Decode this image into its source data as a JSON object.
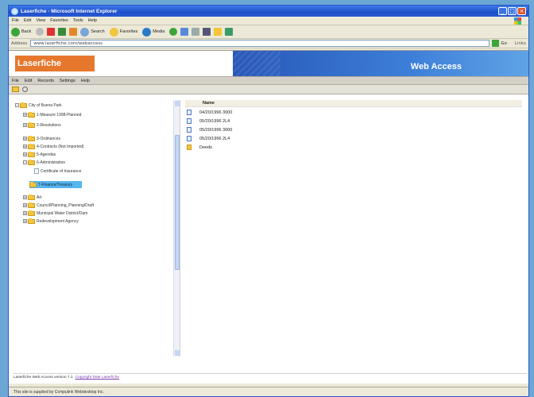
{
  "window": {
    "title": "Laserfiche - Microsoft Internet Explorer"
  },
  "browser_menu": [
    "File",
    "Edit",
    "View",
    "Favorites",
    "Tools",
    "Help"
  ],
  "browser_toolbar": {
    "back_label": "Back",
    "search_label": "Search",
    "favorites_label": "Favorites",
    "media_label": "Media"
  },
  "address": {
    "label": "Address",
    "url": "www.laserfiche.com/webaccess",
    "go_label": "Go",
    "links_label": "Links"
  },
  "banner": {
    "logo_text": "Laserfiche",
    "product_title": "Web Access"
  },
  "app_menu": [
    "File",
    "Edit",
    "Records",
    "Settings",
    "Help"
  ],
  "tree": [
    {
      "label": "City of Buena Park",
      "type": "folder",
      "expander": "-"
    },
    {
      "label": "1-Measure 1998-Planned",
      "type": "folder",
      "expander": "+"
    },
    {
      "label": "2-Resolutions",
      "type": "folder",
      "expander": "+"
    },
    {
      "label": "3-Ordinances",
      "type": "folder",
      "expander": "+"
    },
    {
      "label": "4-Contracts (Not Imported)",
      "type": "folder",
      "expander": "+"
    },
    {
      "label": "5-Agendas",
      "type": "folder",
      "expander": "+"
    },
    {
      "label": "6-Administration",
      "type": "folder",
      "expander": "-"
    },
    {
      "label": "Certificate of Insurance",
      "type": "document",
      "expander": ""
    },
    {
      "label": "7-Finance/Treasury",
      "type": "folder",
      "expander": "+",
      "selected": true
    },
    {
      "label": "Art",
      "type": "folder",
      "expander": "+"
    },
    {
      "label": "Council/Planning_Planning/Draft",
      "type": "folder",
      "expander": "+"
    },
    {
      "label": "Municipal Water District/Dam",
      "type": "folder",
      "expander": "+"
    },
    {
      "label": "Redevelopment Agency",
      "type": "folder",
      "expander": "+"
    }
  ],
  "list": {
    "header": "Name",
    "rows": [
      {
        "name": "04/20/1996 3000",
        "type": "document"
      },
      {
        "name": "05/20/1996 2L4",
        "type": "document"
      },
      {
        "name": "05/20/1996 3000",
        "type": "document"
      },
      {
        "name": "05/20/1996 2L4",
        "type": "document"
      },
      {
        "name": "Deeds",
        "type": "folder"
      }
    ]
  },
  "footer": {
    "version_text": "Laserfiche Web Access version 7.1",
    "link_text": "Copyright Date Laserfiche"
  },
  "status": {
    "text": "This site is supplied by Compulink Webdesktop Inc."
  },
  "colors": {
    "accent": "#e6782e",
    "banner_blue": "#2756b8",
    "selection": "#56b6ef"
  }
}
